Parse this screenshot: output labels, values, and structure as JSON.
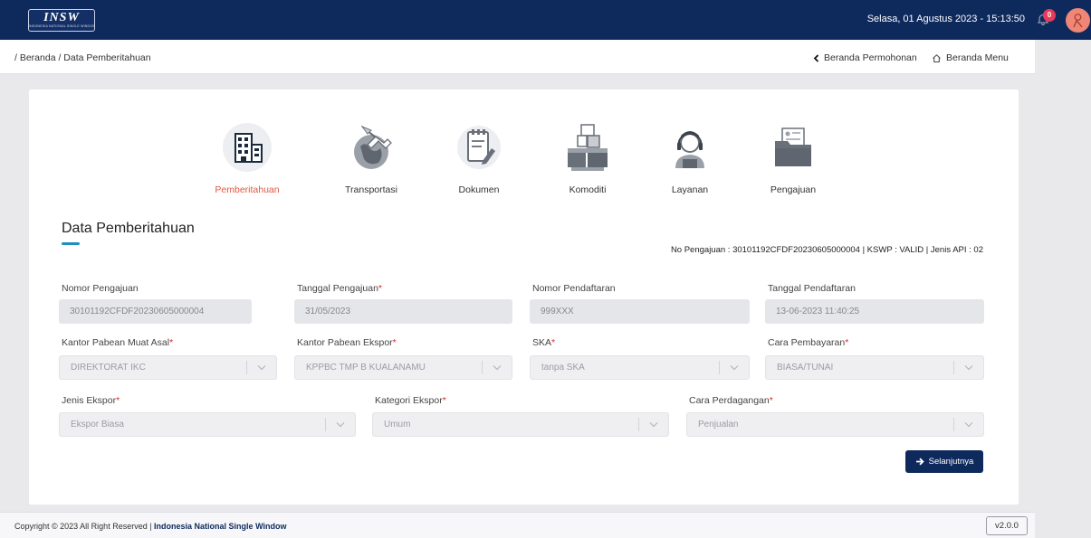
{
  "header": {
    "logo_text": "INSW",
    "logo_subtext": "INDONESIA NATIONAL SINGLE WINDOW",
    "datetime": "Selasa, 01 Agustus 2023 - 15:13:50",
    "notification_count": "0"
  },
  "breadcrumb": "/ Beranda / Data Pemberitahuan",
  "nav": {
    "beranda_permohonan": "Beranda Permohonan",
    "beranda_menu": "Beranda Menu"
  },
  "steps": [
    {
      "label": "Pemberitahuan",
      "icon": "building-icon",
      "active": true
    },
    {
      "label": "Transportasi",
      "icon": "airplane-globe-icon",
      "active": false
    },
    {
      "label": "Dokumen",
      "icon": "document-icon",
      "active": false
    },
    {
      "label": "Komoditi",
      "icon": "boxes-icon",
      "active": false
    },
    {
      "label": "Layanan",
      "icon": "customer-service-icon",
      "active": false
    },
    {
      "label": "Pengajuan",
      "icon": "folder-icon",
      "active": false
    }
  ],
  "section": {
    "title": "Data Pemberitahuan",
    "info": "No Pengajuan : 30101192CFDF20230605000004 | KSWP : VALID | Jenis API : 02"
  },
  "form": {
    "nomor_pengajuan": {
      "label": "Nomor Pengajuan",
      "value": "30101192CFDF20230605000004"
    },
    "tanggal_pengajuan": {
      "label": "Tanggal Pengajuan",
      "value": "31/05/2023"
    },
    "nomor_pendaftaran": {
      "label": "Nomor Pendaftaran",
      "value": "999XXX"
    },
    "tanggal_pendaftaran": {
      "label": "Tanggal Pendaftaran",
      "value": "13-06-2023 11:40:25"
    },
    "kantor_muat_asal": {
      "label": "Kantor Pabean Muat Asal",
      "value": "DIREKTORAT IKC"
    },
    "kantor_ekspor": {
      "label": "Kantor Pabean Ekspor",
      "value": "KPPBC TMP B KUALANAMU"
    },
    "ska": {
      "label": "SKA",
      "value": "tanpa SKA"
    },
    "cara_pembayaran": {
      "label": "Cara Pembayaran",
      "value": "BIASA/TUNAI"
    },
    "jenis_ekspor": {
      "label": "Jenis Ekspor",
      "value": "Ekspor Biasa"
    },
    "kategori_ekspor": {
      "label": "Kategori Ekspor",
      "value": "Umum"
    },
    "cara_perdagangan": {
      "label": "Cara Perdagangan",
      "value": "Penjualan"
    },
    "required_mark": "*"
  },
  "next_button": "Selanjutnya",
  "footer": {
    "copyright_prefix": "Copyright © 2023 All Right Reserved | ",
    "copyright_org": "Indonesia National Single Window",
    "version": "v2.0.0"
  },
  "colors": {
    "navy": "#0e2a5c",
    "active_step": "#e2573f",
    "accent_underline": "#1c8fbd",
    "required": "#e0252b"
  }
}
